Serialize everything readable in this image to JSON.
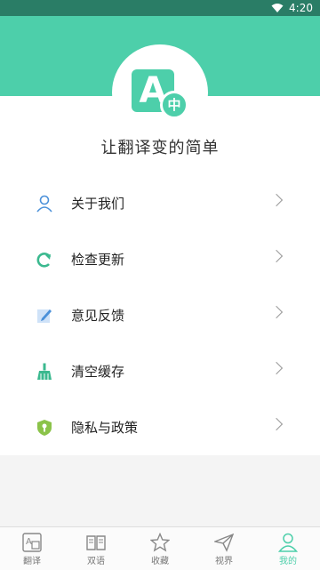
{
  "status": {
    "time": "4:20"
  },
  "profile": {
    "logo_badge": "中",
    "logo_letter": "A",
    "tagline": "让翻译变的简单"
  },
  "menu": [
    {
      "label": "关于我们",
      "icon": "person-icon"
    },
    {
      "label": "检查更新",
      "icon": "refresh-icon"
    },
    {
      "label": "意见反馈",
      "icon": "edit-icon"
    },
    {
      "label": "清空缓存",
      "icon": "broom-icon"
    },
    {
      "label": "隐私与政策",
      "icon": "shield-icon"
    }
  ],
  "bottom_nav": [
    {
      "label": "翻译",
      "icon": "translate-icon",
      "active": false
    },
    {
      "label": "双语",
      "icon": "book-icon",
      "active": false
    },
    {
      "label": "收藏",
      "icon": "star-icon",
      "active": false
    },
    {
      "label": "视界",
      "icon": "paper-plane-icon",
      "active": false
    },
    {
      "label": "我的",
      "icon": "user-icon",
      "active": true
    }
  ],
  "colors": {
    "accent": "#4dcfaa",
    "status_bar": "#2a7d66"
  }
}
